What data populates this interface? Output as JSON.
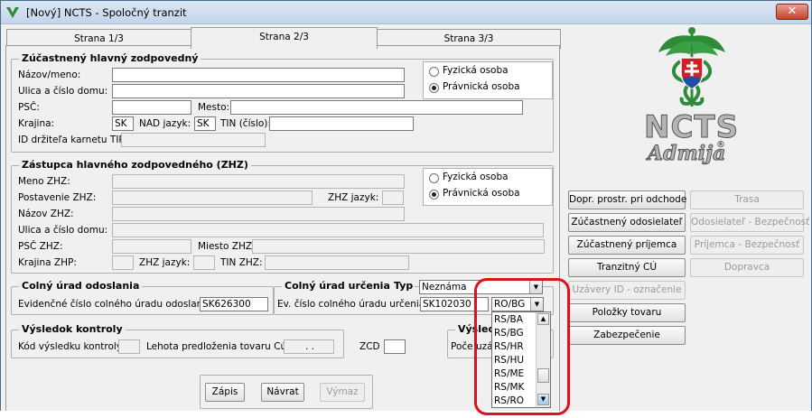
{
  "window": {
    "title": "[Nový] NCTS - Spoločný tranzit",
    "close_label": "✕"
  },
  "tabs": [
    {
      "label": "Strana 1/3"
    },
    {
      "label": "Strana 2/3"
    },
    {
      "label": "Strana 3/3"
    }
  ],
  "group_principal": {
    "title": "Zúčastnený hlavný zodpovedný",
    "name_label": "Názov/meno:",
    "name_value": "",
    "street_label": "Ulica a číslo domu:",
    "street_value": "",
    "psc_label": "PSČ:",
    "psc_value": "",
    "city_label": "Mesto:",
    "city_value": "",
    "country_label": "Krajina:",
    "country_value": "SK",
    "nad_label": "NAD jazyk:",
    "nad_value": "SK",
    "tin_label": "TIN (číslo):",
    "tin_value": "",
    "tir_label": "ID držiteľa karnetu TIR:",
    "tir_value": "",
    "radio_natural": "Fyzická osoba",
    "radio_legal": "Právnická osoba"
  },
  "group_representative": {
    "title": "Zástupca hlavného zodpovedného (ZHZ)",
    "name_label": "Meno ZHZ:",
    "position_label": "Postavenie ZHZ:",
    "zhz_lang_label": "ZHZ jazyk:",
    "company_label": "Názov ZHZ:",
    "street_label": "Ulica a číslo domu:",
    "psc_label": "PSČ ZHZ:",
    "city_label": "Miesto ZHZ:",
    "country_label": "Krajina ZHP:",
    "lang_label": "ZHZ jazyk:",
    "tin_label": "TIN ZHZ:",
    "radio_natural": "Fyzická osoba",
    "radio_legal": "Právnická osoba"
  },
  "group_departure": {
    "title": "Colný úrad odoslania",
    "ref_label": "Evidenčné číslo colného úradu odoslania:",
    "ref_value": "SK626300"
  },
  "group_destination": {
    "title": "Colný úrad určenia",
    "type_label": "Typ",
    "type_value": "Neznáma",
    "ref_label": "Ev. číslo colného úradu určenia:",
    "ref_value": "SK102030",
    "country_value": "RO/BG"
  },
  "dropdown": {
    "items": [
      "RS/BA",
      "RS/BG",
      "RS/HR",
      "RS/HU",
      "RS/ME",
      "RS/MK",
      "RS/RO"
    ]
  },
  "group_control": {
    "title": "Výsledok kontroly",
    "code_label": "Kód výsledku kontroly:",
    "deadline_label": "Lehota predloženia tovaru Cúu:",
    "deadline_value": ". .",
    "zcd_label": "ZCD"
  },
  "group_seals": {
    "title": "Výsledo",
    "count_label": "Poče uzá"
  },
  "bottom_buttons": {
    "save": "Zápis",
    "back": "Návrat",
    "delete": "Výmaz"
  },
  "side_buttons_left": [
    {
      "label": "Dopr. prostr. pri odchode"
    },
    {
      "label": "Zúčastnený odosielateľ"
    },
    {
      "label": "Zúčastnený príjemca"
    },
    {
      "label": "Tranzitný CÚ"
    },
    {
      "label": "Uzávery ID - označenie"
    },
    {
      "label": "Položky tovaru"
    },
    {
      "label": "Zabezpečenie"
    }
  ],
  "side_buttons_right": [
    {
      "label": "Trasa"
    },
    {
      "label": "Odosielateľ - Bezpečnosť"
    },
    {
      "label": "Príjemca - Bezpečnosť"
    },
    {
      "label": "Dopravca"
    }
  ],
  "logo": {
    "title": "NCTS",
    "subtitle": "Admija",
    "reg_mark": "®"
  },
  "colors": {
    "highlight": "#d9141c",
    "logo_green": "#2e8b3a",
    "shield_red": "#d32027",
    "shield_blue": "#1f4fa3"
  }
}
